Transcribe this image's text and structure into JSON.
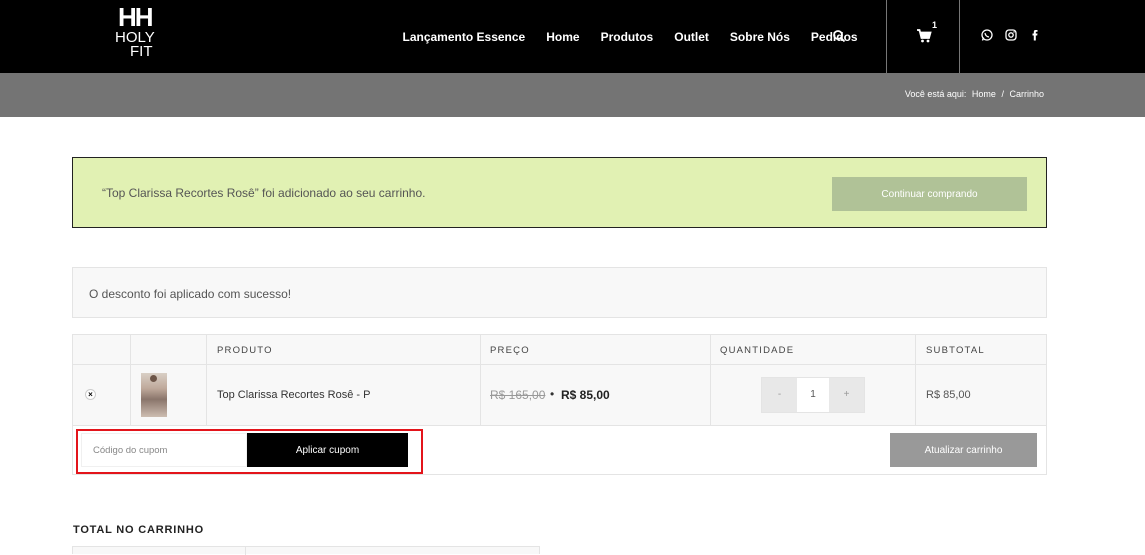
{
  "header": {
    "logo": {
      "line1": "HOLY",
      "line2": "FIT"
    },
    "nav": [
      "Lançamento Essence",
      "Home",
      "Produtos",
      "Outlet",
      "Sobre Nós",
      "Pedidos"
    ],
    "cart_count": "1"
  },
  "breadcrumb": {
    "prefix": "Você está aqui:",
    "home": "Home",
    "separator": "/",
    "current": "Carrinho"
  },
  "notice": {
    "message": "“Top Clarissa Recortes Rosê” foi adicionado ao seu carrinho.",
    "button": "Continuar comprando"
  },
  "discount_message": "O desconto foi aplicado com sucesso!",
  "cart_table": {
    "headers": {
      "product": "PRODUTO",
      "price": "PREÇO",
      "quantity": "QUANTIDADE",
      "subtotal": "SUBTOTAL"
    },
    "row": {
      "name": "Top Clarissa Recortes Rosê - P",
      "old_price": "R$ 165,00",
      "new_price": "R$ 85,00",
      "qty_minus": "-",
      "qty": "1",
      "qty_plus": "+",
      "subtotal": "R$ 85,00",
      "remove": "×"
    },
    "coupon_placeholder": "Código do cupom",
    "apply_coupon": "Aplicar cupom",
    "update_cart": "Atualizar carrinho"
  },
  "totals": {
    "title": "TOTAL NO CARRINHO"
  },
  "colors": {
    "notice_bg": "#e1f1b3",
    "highlight": "#e3141b",
    "header_bg": "#000000",
    "breadcrumb_bg": "#747474"
  }
}
